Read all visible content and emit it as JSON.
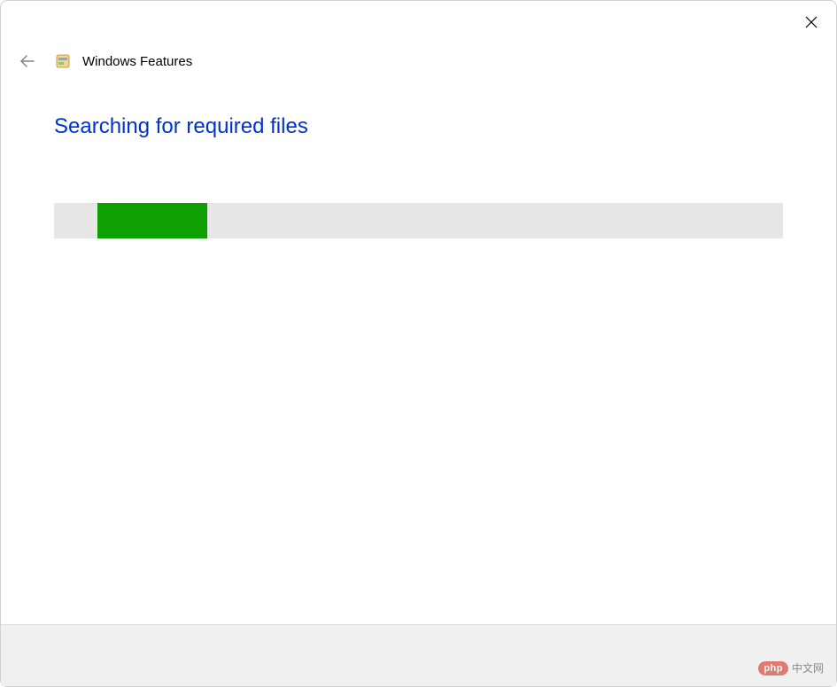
{
  "header": {
    "title": "Windows Features"
  },
  "content": {
    "status_heading": "Searching for required files"
  },
  "progress": {
    "offset_percent": 6,
    "width_percent": 15,
    "track_color": "#e6e6e6",
    "fill_color": "#0ea000"
  },
  "watermark": {
    "badge": "php",
    "text": "中文网"
  }
}
